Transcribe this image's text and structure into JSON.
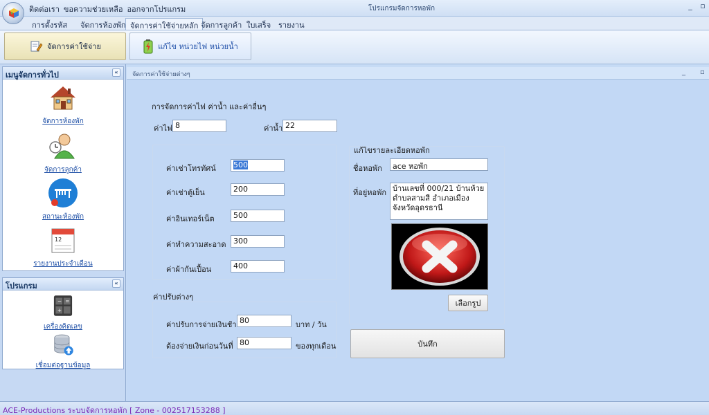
{
  "titlebar": {
    "quick_menu": [
      "ติดต่อเรา",
      "ขอความช่วยเหลือ",
      "ออกจากโปรแกรม"
    ],
    "window_title": "โปรแกรมจัดการหอพัก",
    "minimize": "_",
    "maximize": "▫"
  },
  "tabs": [
    "การตั้งรหัส",
    "จัดการห้องพัก",
    "จัดการค่าใช้จ่ายหลัก",
    "จัดการลูกค้า",
    "ใบเสร็จ",
    "รายงาน"
  ],
  "active_tab": "จัดการค่าใช้จ่ายหลัก",
  "ribbon": {
    "expense_button": "จัดการค่าใช้จ่าย",
    "utility_button": "แก้ไข หน่วยไฟ หน่วยน้ำ"
  },
  "sidebar": {
    "general_title": "เมนูจัดการทั่วไป",
    "general_items": [
      "จัดการห้องพัก",
      "จัดการลูกค้า",
      "สถานะห้องพัก",
      "รายงานประจำเดือน"
    ],
    "program_title": "โปรแกรม",
    "program_items": [
      "เครื่องคิดเลข",
      "เชื่อมต่อฐานข้อมูล"
    ],
    "collapse_glyph": "«"
  },
  "content": {
    "header": "จัดการค่าใช้จ่ายต่างๆ",
    "section_title": "การจัดการค่าไฟ ค่าน้ำ และค่าอื่นๆ",
    "electric_label": "ค่าไฟ",
    "electric_value": "8",
    "water_label": "ค่าน้ำ",
    "water_value": "22",
    "fees": [
      {
        "label": "ค่าเช่าโทรทัศน์",
        "value": "500"
      },
      {
        "label": "ค่าเช่าตู้เย็น",
        "value": "200"
      },
      {
        "label": "ค่าอินเทอร์เน็ต",
        "value": "500"
      },
      {
        "label": "ค่าทำความสะอาด",
        "value": "300"
      },
      {
        "label": "ค่าผ้ากันเปื้อน",
        "value": "400"
      }
    ],
    "penalty_title": "ค่าปรับต่างๆ",
    "penalty_late_label": "ค่าปรับการจ่ายเงินช้า",
    "penalty_late_value": "80",
    "penalty_late_unit": "บาท / วัน",
    "pay_before_label": "ต้องจ่ายเงินก่อนวันที่",
    "pay_before_value": "80",
    "pay_before_unit": "ของทุกเดือน",
    "dorm_section_title": "แก้ไขรายละเอียดหอพัก",
    "dorm_name_label": "ชื่อหอพัก",
    "dorm_name_value": "ace หอพัก",
    "dorm_addr_label": "ที่อยู่หอพัก",
    "dorm_addr_lines": [
      "บ้านเลขที่ 000/21 บ้านห้วย",
      "ตำบลสามสี อำเภอเมือง",
      "จังหวัดอุดรธานี"
    ],
    "choose_image": "เลือกรูป",
    "save": "บันทึก"
  },
  "statusbar": "ACE-Productions ระบบจัดการหอพัก [ Zone - 002517153288 ]"
}
